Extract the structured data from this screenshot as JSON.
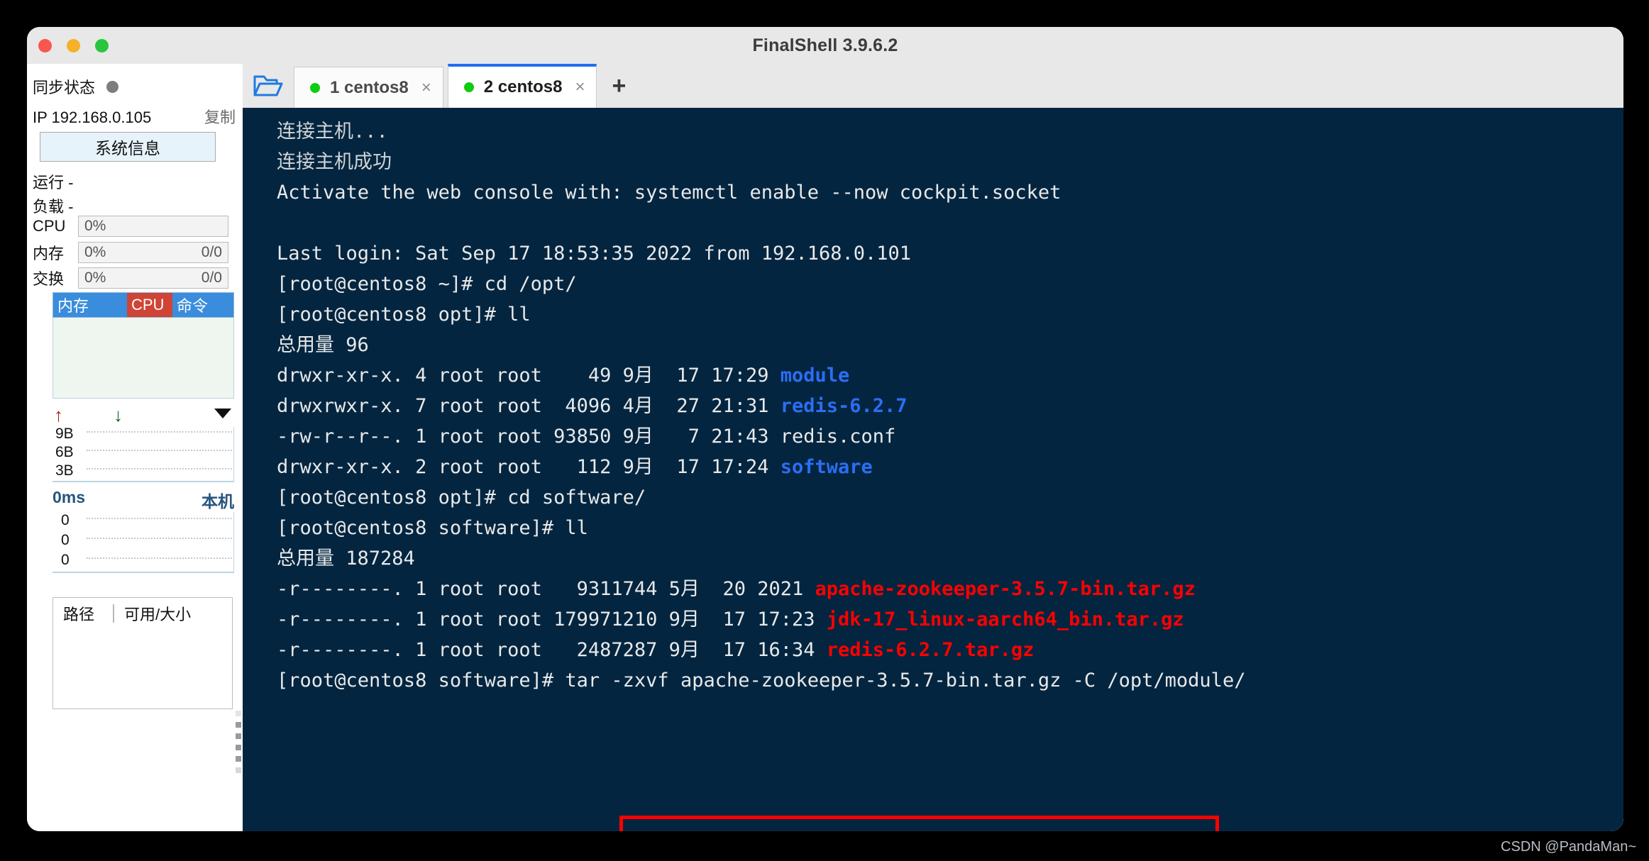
{
  "window": {
    "title": "FinalShell 3.9.6.2",
    "traffic_lights": [
      "close",
      "minimize",
      "maximize"
    ]
  },
  "sidebar": {
    "sync_status_label": "同步状态",
    "sync_status_state": "offline",
    "ip_label": "IP 192.168.0.105",
    "copy_label": "复制",
    "system_info_button": "系统信息",
    "uptime_label": "运行 -",
    "load_label": "负载 -",
    "meters": [
      {
        "name": "CPU",
        "value": "0%",
        "detail": ""
      },
      {
        "name": "内存",
        "value": "0%",
        "detail": "0/0"
      },
      {
        "name": "交换",
        "value": "0%",
        "detail": "0/0"
      }
    ],
    "process_table": {
      "columns": [
        "内存",
        "CPU",
        "命令"
      ],
      "rows": []
    },
    "network": {
      "upload_icon": "arrow-up",
      "download_icon": "arrow-down",
      "expand_icon": "chevron-down",
      "y_ticks": [
        "9B",
        "6B",
        "3B"
      ]
    },
    "latency": {
      "value": "0ms",
      "target": "本机",
      "y_ticks": [
        "0",
        "0",
        "0"
      ]
    },
    "disk_table": {
      "columns": [
        "路径",
        "可用/大小"
      ],
      "rows": []
    }
  },
  "tabbar": {
    "folder_icon": "folder-open-icon",
    "new_tab_icon": "plus-icon",
    "tabs": [
      {
        "label": "1 centos8",
        "status": "connected",
        "active": false,
        "close_icon": "×"
      },
      {
        "label": "2 centos8",
        "status": "connected",
        "active": true,
        "close_icon": "×"
      }
    ]
  },
  "terminal": {
    "lines": [
      {
        "id": "l1",
        "segments": [
          {
            "text": "连接主机...",
            "color": "dim"
          }
        ]
      },
      {
        "id": "l2",
        "segments": [
          {
            "text": "连接主机成功",
            "color": "dim"
          }
        ]
      },
      {
        "id": "l3",
        "segments": [
          {
            "text": "Activate the web console with: systemctl enable --now cockpit.socket",
            "color": "normal"
          }
        ]
      },
      {
        "id": "l4",
        "segments": [
          {
            "text": " ",
            "color": "normal"
          }
        ]
      },
      {
        "id": "l5",
        "segments": [
          {
            "text": "Last login: Sat Sep 17 18:53:35 2022 from 192.168.0.101",
            "color": "normal"
          }
        ]
      },
      {
        "id": "l6",
        "segments": [
          {
            "text": "[root@centos8 ~]# cd /opt/",
            "color": "normal"
          }
        ]
      },
      {
        "id": "l7",
        "segments": [
          {
            "text": "[root@centos8 opt]# ll",
            "color": "normal"
          }
        ]
      },
      {
        "id": "l8",
        "segments": [
          {
            "text": "总用量 96",
            "color": "normal"
          }
        ]
      },
      {
        "id": "l9",
        "segments": [
          {
            "text": "drwxr-xr-x. 4 root root    49 9月  17 17:29 ",
            "color": "normal"
          },
          {
            "text": "module",
            "color": "blue"
          }
        ]
      },
      {
        "id": "l10",
        "segments": [
          {
            "text": "drwxrwxr-x. 7 root root  4096 4月  27 21:31 ",
            "color": "normal"
          },
          {
            "text": "redis-6.2.7",
            "color": "blue"
          }
        ]
      },
      {
        "id": "l11",
        "segments": [
          {
            "text": "-rw-r--r--. 1 root root 93850 9月   7 21:43 redis.conf",
            "color": "normal"
          }
        ]
      },
      {
        "id": "l12",
        "segments": [
          {
            "text": "drwxr-xr-x. 2 root root   112 9月  17 17:24 ",
            "color": "normal"
          },
          {
            "text": "software",
            "color": "blue"
          }
        ]
      },
      {
        "id": "l13",
        "segments": [
          {
            "text": "[root@centos8 opt]# cd software/",
            "color": "normal"
          }
        ]
      },
      {
        "id": "l14",
        "segments": [
          {
            "text": "[root@centos8 software]# ll",
            "color": "normal"
          }
        ]
      },
      {
        "id": "l15",
        "segments": [
          {
            "text": "总用量 187284",
            "color": "normal"
          }
        ]
      },
      {
        "id": "l16",
        "segments": [
          {
            "text": "-r--------. 1 root root   9311744 5月  20 2021 ",
            "color": "normal"
          },
          {
            "text": "apache-zookeeper-3.5.7-bin.tar.gz",
            "color": "red"
          }
        ]
      },
      {
        "id": "l17",
        "segments": [
          {
            "text": "-r--------. 1 root root 179971210 9月  17 17:23 ",
            "color": "normal"
          },
          {
            "text": "jdk-17_linux-aarch64_bin.tar.gz",
            "color": "red"
          }
        ]
      },
      {
        "id": "l18",
        "segments": [
          {
            "text": "-r--------. 1 root root   2487287 9月  17 16:34 ",
            "color": "normal"
          },
          {
            "text": "redis-6.2.7.tar.gz",
            "color": "red"
          }
        ]
      },
      {
        "id": "l19",
        "segments": [
          {
            "text": "[root@centos8 software]# tar -zxvf apache-zookeeper-3.5.7-bin.tar.gz -C /opt/module/",
            "color": "normal"
          }
        ]
      }
    ],
    "highlight_annotation_color": "#ff0000"
  },
  "watermark": "CSDN @PandaMan~"
}
